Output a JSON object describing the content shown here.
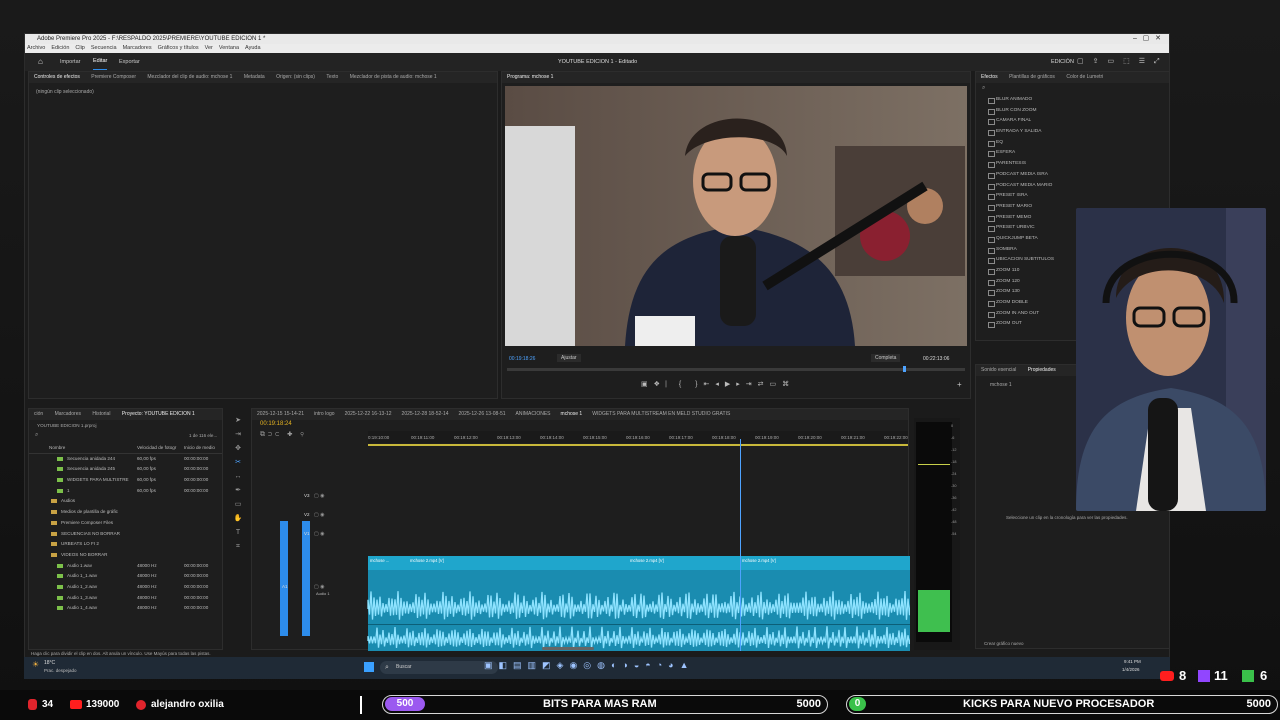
{
  "window": {
    "title": "Adobe Premiere Pro 2025 - F:\\RESPALDO 2025\\PREMIERE\\YOUTUBE EDICION 1 *",
    "menu": [
      "Archivo",
      "Edición",
      "Clip",
      "Secuencia",
      "Marcadores",
      "Gráficos y títulos",
      "Ver",
      "Ventana",
      "Ayuda"
    ]
  },
  "appbar": {
    "tabs": [
      "Importar",
      "Editar",
      "Exportar"
    ],
    "center_title": "YOUTUBE EDICION 1",
    "center_state": "Editado",
    "workspace": "EDICIÓN"
  },
  "source_panel": {
    "tabs": [
      "Controles de efectos",
      "Premiere Composer",
      "Mezclador del clip de audio: mchose 1",
      "Metadata",
      "Origen: (sin clips)",
      "Texto",
      "Mezclador de pista de audio: mchose 1"
    ],
    "empty_text": "(ningún clip seleccionado)"
  },
  "program": {
    "tab": "Programa: mchose 1",
    "timecode": "00:19:18:26",
    "fit": "Ajustar",
    "quality": "Completa",
    "duration": "00:22:13:06"
  },
  "effects": {
    "tabs": [
      "Efectos",
      "Plantillas de gráficos",
      "Color de Lumetri"
    ],
    "items": [
      "BLUR ANIMADO",
      "BLUR CON ZOOM",
      "CAMARA FINAL",
      "ENTRADA Y SALIDA",
      "EQ",
      "ESFERA",
      "PARENTESIS",
      "PODCAST MEDIA ISRA",
      "PODCAST MEDIA MARIO",
      "PRESET ISRA",
      "PRESET MARIO",
      "PRESET MEMO",
      "PRESET URBVIC",
      "QUICKJUMP BETA",
      "SOMBRA",
      "UBICACION SUBTITULOS",
      "ZOOM 110",
      "ZOOM 120",
      "ZOOM 130",
      "ZOOM DOBLE",
      "ZOOM IN AND OUT",
      "ZOOM OUT"
    ]
  },
  "properties": {
    "tabs": [
      "Sonido esencial",
      "Propiedades"
    ],
    "clip": "mchose 1",
    "hint": "Seleccione un clip en la cronología para ver las propiedades."
  },
  "project": {
    "tabs": [
      "ción",
      "Marcadores",
      "Historial",
      "Proyecto: YOUTUBE EDICION 1"
    ],
    "file": "YOUTUBE EDICION 1.prproj",
    "count": "1 de 116 ele...",
    "cols": [
      "Nombre",
      "Velocidad de fotogr",
      "Inicio de medio"
    ],
    "items": [
      {
        "name": "Secuencia anidada 244",
        "fps": "60,00 fps",
        "start": "00:00:00:00"
      },
      {
        "name": "Secuencia anidada 245",
        "fps": "60,00 fps",
        "start": "00:00:00:00"
      },
      {
        "name": "WIDGETS PARA MULTISTRE",
        "fps": "60,00 fps",
        "start": "00:00:00:00"
      },
      {
        "name": "1",
        "fps": "60,00 fps",
        "start": "00:00:00:00"
      },
      {
        "name": "Audios",
        "fps": "",
        "start": ""
      },
      {
        "name": "Medios de plantilla de gráfic",
        "fps": "",
        "start": ""
      },
      {
        "name": "Premiere Composer Files",
        "fps": "",
        "start": ""
      },
      {
        "name": "SECUENCIAS NO BORRAR",
        "fps": "",
        "start": ""
      },
      {
        "name": "URBEATS LO FI 2",
        "fps": "",
        "start": ""
      },
      {
        "name": "VIDEOS NO BORRAR",
        "fps": "",
        "start": ""
      },
      {
        "name": "Audio 1.wav",
        "fps": "48000 Hz",
        "start": "00:00:00:00"
      },
      {
        "name": "Audio 1_1.wav",
        "fps": "48000 Hz",
        "start": "00:00:00:00"
      },
      {
        "name": "Audio 1_2.wav",
        "fps": "48000 Hz",
        "start": "00:00:00:00"
      },
      {
        "name": "Audio 1_3.wav",
        "fps": "48000 Hz",
        "start": "00:00:00:00"
      },
      {
        "name": "Audio 1_4.wav",
        "fps": "48000 Hz",
        "start": "00:00:00:00"
      }
    ]
  },
  "timeline": {
    "tabs": [
      "2025-12-15 15-14-21",
      "intro logo",
      "2025-12-22 16-13-12",
      "2025-12-28 18-52-14",
      "2025-12-26 13-08-51",
      "ANIMACIONES",
      "mchose 1",
      "WIDGETS PARA MULTISTREAM EN MELD STUDIO GRATIS"
    ],
    "timecode": "00:19:18:24",
    "ruler": [
      "0:19:10:00",
      "00:19:11:00",
      "00:19:12:00",
      "00:19:13:00",
      "00:19:14:00",
      "00:19:15:00",
      "00:19:16:00",
      "00:19:17:00",
      "00:19:18:00",
      "00:19:19:00",
      "00:19:20:00",
      "00:19:21:00",
      "00:19:22:00"
    ],
    "tracks": [
      "V3",
      "V2",
      "V1",
      "A1"
    ],
    "audio_track_name": "Audio 1",
    "clips": [
      "mchose ...",
      "mchose 2.mp4 [V]",
      "mchose 2.mp4 [V]",
      "mchose 2.mp4 [V]"
    ]
  },
  "meter": {
    "scale": [
      "0",
      "-6",
      "-12",
      "-18",
      "-24",
      "-30",
      "-36",
      "-42",
      "-48",
      "-54"
    ]
  },
  "status": {
    "hint": "Haga clic para dividir el clip en dos. Alt anula un vínculo. Use Mayús para todas las pistas.",
    "crear": "Crear gráfico nuevo"
  },
  "taskbar": {
    "temp": "18°C",
    "weather": "Prac. despejado",
    "search": "Buscar",
    "time": "9:41 PM",
    "date": "1/4/2026"
  },
  "stream": {
    "left_count1": "34",
    "left_count2": "139000",
    "user": "alejandro oxilia",
    "goal1": {
      "badge": "500",
      "label": "BITS PARA MAS RAM",
      "target": "5000"
    },
    "goal2": {
      "badge": "0",
      "label": "KICKS PARA NUEVO PROCESADOR",
      "target": "5000"
    },
    "yt": "8",
    "twitch": "11",
    "kick": "6"
  },
  "colors": {
    "accent": "#2d8ceb",
    "clip": "#1fa6cc",
    "wave": "#8ee3ff",
    "meter": "#3fbf4f",
    "goal1": "#9b59f0",
    "goal2": "#3ac14a"
  }
}
